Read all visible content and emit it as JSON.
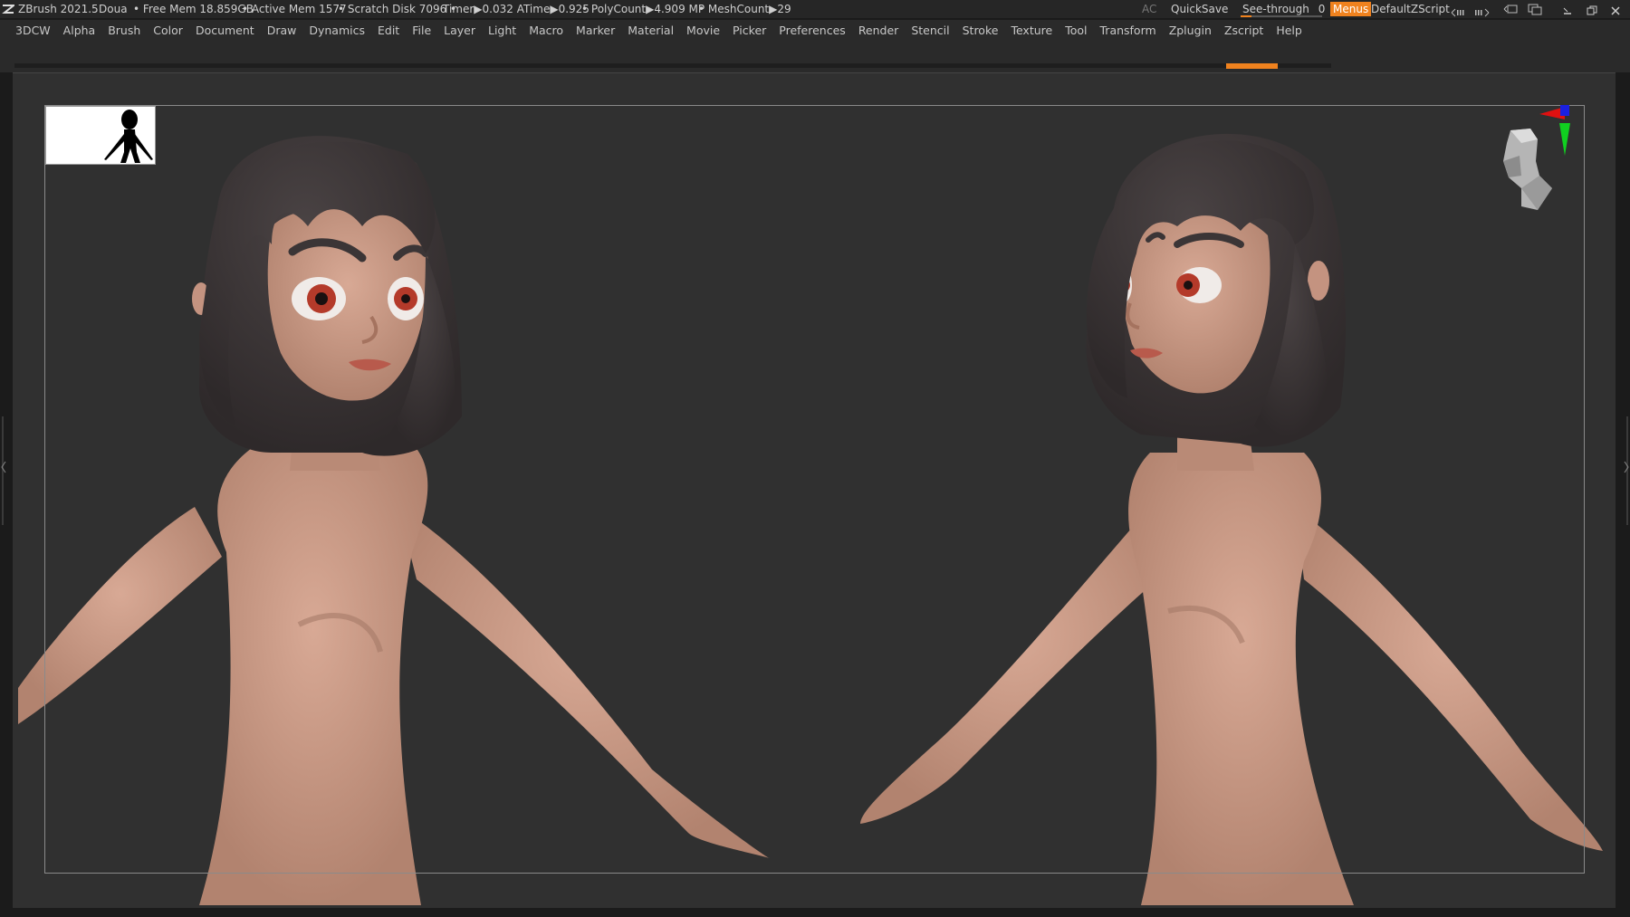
{
  "titlebar": {
    "app_title": "ZBrush 2021.5",
    "doc_name": "Doua",
    "free_mem": "• Free Mem 18.859GB",
    "active_mem": "• Active Mem 1577",
    "scratch_disk": "• Scratch Disk 7096 •",
    "timer": "Timer▶0.032 ATime▶0.925",
    "polycount": "• PolyCount▶4.909 MP",
    "meshcount": "• MeshCount▶29",
    "ac": "AC",
    "quicksave": "QuickSave",
    "see_through_label": "See-through",
    "see_through_value": "0",
    "menus": "Menus",
    "default_zscript": "DefaultZScript"
  },
  "menubar": {
    "items": [
      "3DCW",
      "Alpha",
      "Brush",
      "Color",
      "Document",
      "Draw",
      "Dynamics",
      "Edit",
      "File",
      "Layer",
      "Light",
      "Macro",
      "Marker",
      "Material",
      "Movie",
      "Picker",
      "Preferences",
      "Render",
      "Stencil",
      "Stroke",
      "Texture",
      "Tool",
      "Transform",
      "Zplugin",
      "Zscript",
      "Help"
    ]
  },
  "colors": {
    "accent": "#f0821e",
    "canvas": "#303030",
    "skin": "#c99a86",
    "hair": "#3b3536",
    "eye_iris": "#b43a2a"
  },
  "icons": {
    "app_logo": "zbrush-logo-icon",
    "navigation": "head-gyro-icon",
    "axis": "xyz-axis-icon"
  }
}
